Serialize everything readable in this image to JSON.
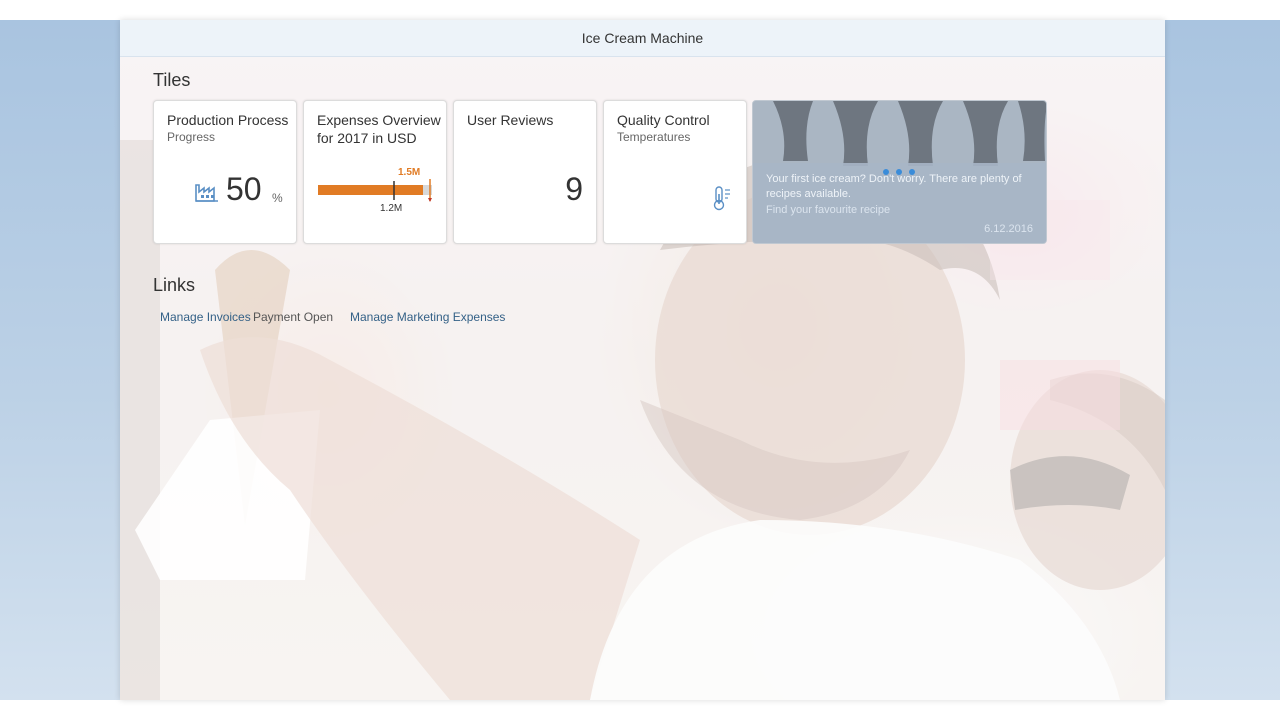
{
  "header": {
    "title": "Ice Cream Machine"
  },
  "sections": {
    "tiles_title": "Tiles",
    "links_title": "Links"
  },
  "tiles": [
    {
      "title": "Production Process",
      "subtitle": "Progress",
      "value": "50",
      "unit": "%",
      "icon": "factory-icon"
    },
    {
      "title": "Expenses Overview for 2017 in USD",
      "target_label": "1.5M",
      "actual_label": "1.2M",
      "actual_fraction": 0.8,
      "target_fraction": 1.0,
      "bar_color": "#e17b24"
    },
    {
      "title": "User Reviews",
      "value": "9"
    },
    {
      "title": "Quality Control",
      "subtitle": "Temperatures",
      "icon": "thermometer-icon"
    }
  ],
  "news": {
    "text": "Your first ice cream? Don't worry. There are plenty of recipes available.",
    "link": "Find your favourite recipe",
    "date": "6.12.2016"
  },
  "links": [
    {
      "label": "Manage Invoices"
    },
    {
      "label": "Payment Open"
    },
    {
      "label": "Manage Marketing Expenses"
    }
  ],
  "colors": {
    "accent": "#3a8cd9",
    "link": "#346187",
    "header_bg": "#edf3f9"
  }
}
